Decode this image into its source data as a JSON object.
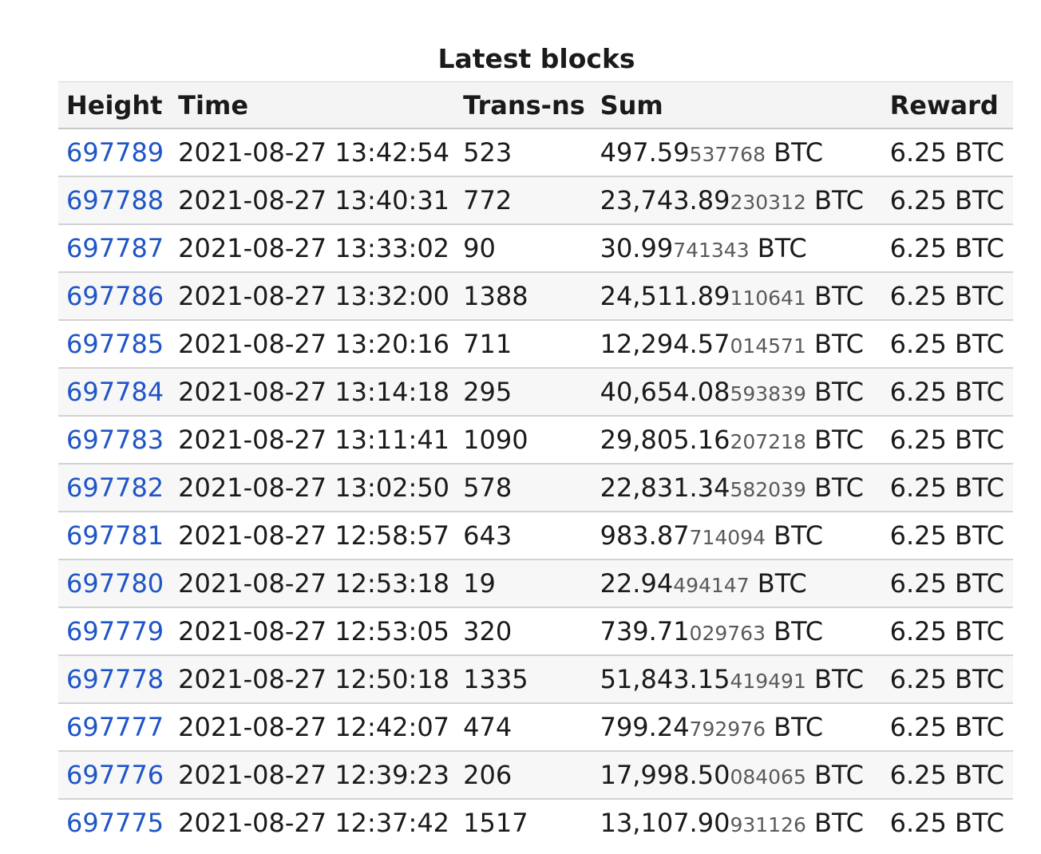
{
  "title": "Latest blocks",
  "headers": {
    "height": "Height",
    "time": "Time",
    "trans": "Trans-ns",
    "sum": "Sum",
    "reward": "Reward"
  },
  "rows": [
    {
      "height": "697789",
      "time": "2021-08-27 13:42:54",
      "trans": "523",
      "sum_main": "497.59",
      "sum_small": "537768",
      "sum_unit": " BTC",
      "reward": "6.25 BTC"
    },
    {
      "height": "697788",
      "time": "2021-08-27 13:40:31",
      "trans": "772",
      "sum_main": "23,743.89",
      "sum_small": "230312",
      "sum_unit": " BTC",
      "reward": "6.25 BTC"
    },
    {
      "height": "697787",
      "time": "2021-08-27 13:33:02",
      "trans": "90",
      "sum_main": "30.99",
      "sum_small": "741343",
      "sum_unit": " BTC",
      "reward": "6.25 BTC"
    },
    {
      "height": "697786",
      "time": "2021-08-27 13:32:00",
      "trans": "1388",
      "sum_main": "24,511.89",
      "sum_small": "110641",
      "sum_unit": " BTC",
      "reward": "6.25 BTC"
    },
    {
      "height": "697785",
      "time": "2021-08-27 13:20:16",
      "trans": "711",
      "sum_main": "12,294.57",
      "sum_small": "014571",
      "sum_unit": " BTC",
      "reward": "6.25 BTC"
    },
    {
      "height": "697784",
      "time": "2021-08-27 13:14:18",
      "trans": "295",
      "sum_main": "40,654.08",
      "sum_small": "593839",
      "sum_unit": " BTC",
      "reward": "6.25 BTC"
    },
    {
      "height": "697783",
      "time": "2021-08-27 13:11:41",
      "trans": "1090",
      "sum_main": "29,805.16",
      "sum_small": "207218",
      "sum_unit": " BTC",
      "reward": "6.25 BTC"
    },
    {
      "height": "697782",
      "time": "2021-08-27 13:02:50",
      "trans": "578",
      "sum_main": "22,831.34",
      "sum_small": "582039",
      "sum_unit": " BTC",
      "reward": "6.25 BTC"
    },
    {
      "height": "697781",
      "time": "2021-08-27 12:58:57",
      "trans": "643",
      "sum_main": "983.87",
      "sum_small": "714094",
      "sum_unit": " BTC",
      "reward": "6.25 BTC"
    },
    {
      "height": "697780",
      "time": "2021-08-27 12:53:18",
      "trans": "19",
      "sum_main": "22.94",
      "sum_small": "494147",
      "sum_unit": " BTC",
      "reward": "6.25 BTC"
    },
    {
      "height": "697779",
      "time": "2021-08-27 12:53:05",
      "trans": "320",
      "sum_main": "739.71",
      "sum_small": "029763",
      "sum_unit": " BTC",
      "reward": "6.25 BTC"
    },
    {
      "height": "697778",
      "time": "2021-08-27 12:50:18",
      "trans": "1335",
      "sum_main": "51,843.15",
      "sum_small": "419491",
      "sum_unit": " BTC",
      "reward": "6.25 BTC"
    },
    {
      "height": "697777",
      "time": "2021-08-27 12:42:07",
      "trans": "474",
      "sum_main": "799.24",
      "sum_small": "792976",
      "sum_unit": " BTC",
      "reward": "6.25 BTC"
    },
    {
      "height": "697776",
      "time": "2021-08-27 12:39:23",
      "trans": "206",
      "sum_main": "17,998.50",
      "sum_small": "084065",
      "sum_unit": " BTC",
      "reward": "6.25 BTC"
    },
    {
      "height": "697775",
      "time": "2021-08-27 12:37:42",
      "trans": "1517",
      "sum_main": "13,107.90",
      "sum_small": "931126",
      "sum_unit": " BTC",
      "reward": "6.25 BTC"
    }
  ]
}
